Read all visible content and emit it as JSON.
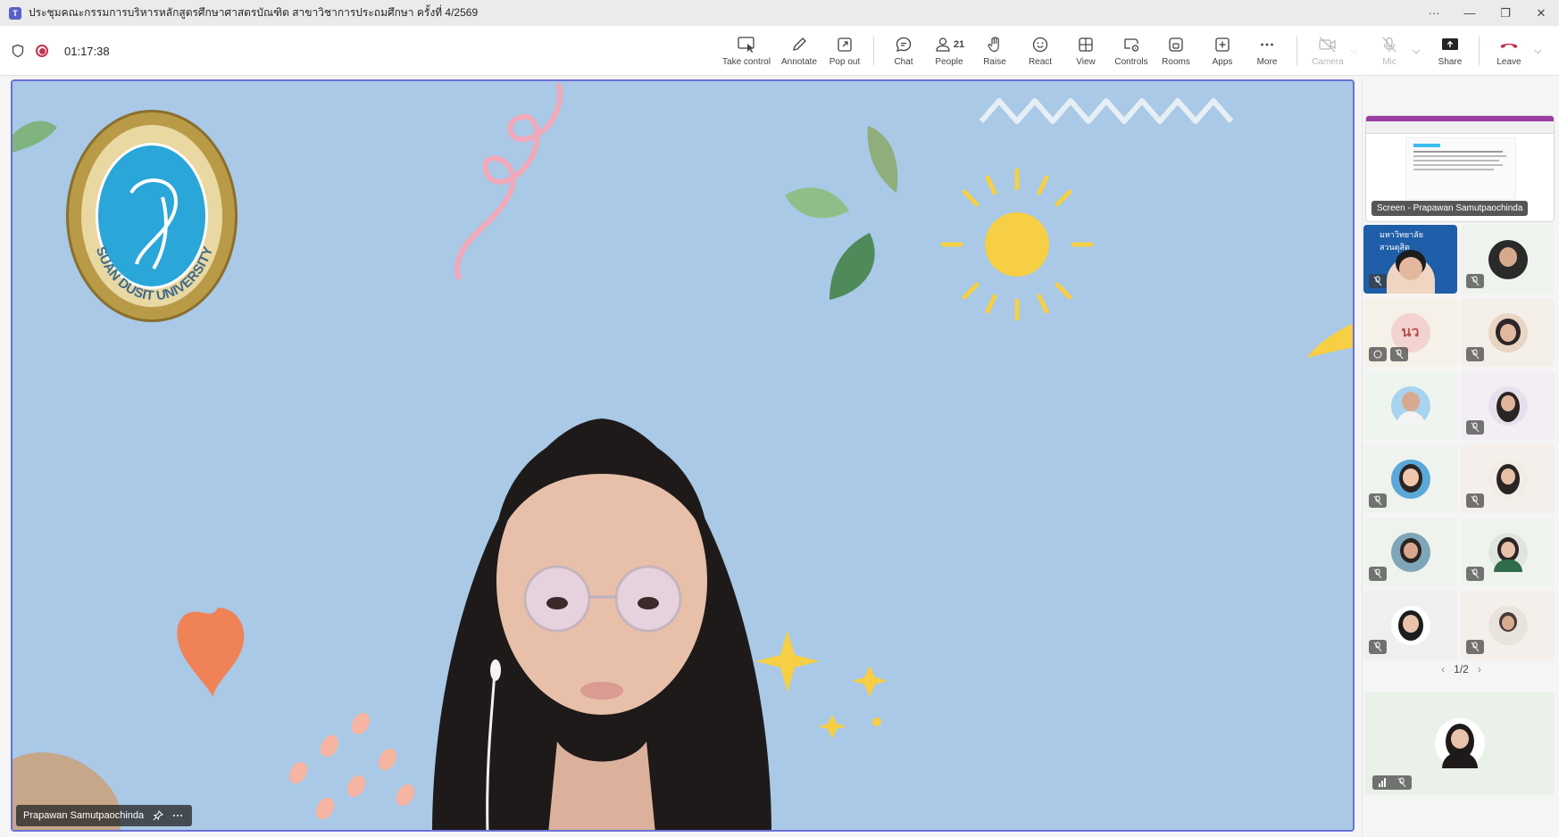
{
  "window": {
    "title": "ประชุมคณะกรรมการบริหารหลักสูตรศึกษาศาสตรบัณฑิต สาขาวิชาการประถมศึกษา ครั้งที่ 4/2569",
    "controls": [
      "···",
      "—",
      "❐",
      "✕"
    ]
  },
  "toolbar": {
    "timer": "01:17:38",
    "take_control": "Take control",
    "annotate": "Annotate",
    "pop_out": "Pop out",
    "chat": "Chat",
    "people": "People",
    "people_count": "21",
    "raise": "Raise",
    "react": "React",
    "view": "View",
    "controls": "Controls",
    "rooms": "Rooms",
    "apps": "Apps",
    "more": "More",
    "camera": "Camera",
    "mic": "Mic",
    "share": "Share",
    "leave": "Leave"
  },
  "stage": {
    "speaker_name": "Prapawan Samutpaochinda",
    "logo_text": "SUAN DUSIT UNIVERSITY",
    "colors": {
      "background": "#a9c9e6",
      "border": "#6b6fd6"
    }
  },
  "panel": {
    "share_label": "Screen - Prapawan Samutpaochinda",
    "share_banner": "มหาวิทยาลัยสวนดุสิต",
    "initials": "นว",
    "pager": "1/2"
  }
}
